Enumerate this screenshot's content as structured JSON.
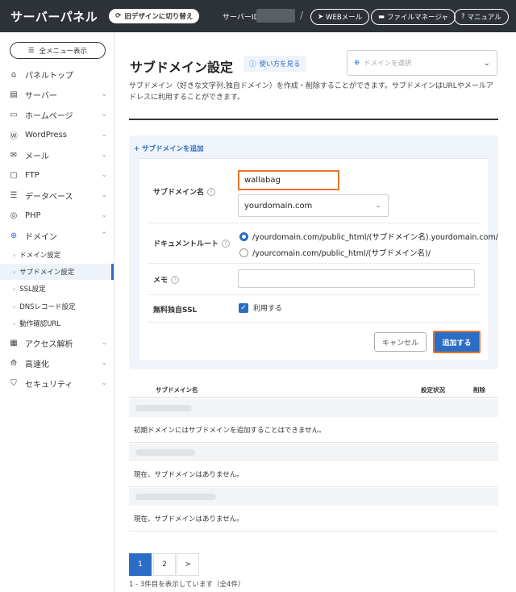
{
  "header": {
    "logo": "サーバーパネル",
    "old_design": "旧デザインに切り替え",
    "server_id_label": "サーバーID",
    "separator": "/",
    "webmail": "WEBメール",
    "file_manager": "ファイルマネージャ",
    "manual": "マニュアル"
  },
  "sidebar": {
    "all_menu": "全メニュー表示",
    "items": [
      {
        "label": "パネルトップ",
        "icon": "home-icon"
      },
      {
        "label": "サーバー",
        "icon": "server-icon"
      },
      {
        "label": "ホームページ",
        "icon": "window-icon"
      },
      {
        "label": "WordPress",
        "icon": "wordpress-icon"
      },
      {
        "label": "メール",
        "icon": "mail-icon"
      },
      {
        "label": "FTP",
        "icon": "monitor-icon"
      },
      {
        "label": "データベース",
        "icon": "database-icon"
      },
      {
        "label": "PHP",
        "icon": "php-icon"
      },
      {
        "label": "ドメイン",
        "icon": "globe-icon"
      }
    ],
    "domain_sub": [
      {
        "label": "ドメイン設定"
      },
      {
        "label": "サブドメイン設定"
      },
      {
        "label": "SSL設定"
      },
      {
        "label": "DNSレコード設定"
      },
      {
        "label": "動作確認URL"
      }
    ],
    "items_after": [
      {
        "label": "アクセス解析",
        "icon": "chart-icon"
      },
      {
        "label": "高速化",
        "icon": "speed-icon"
      },
      {
        "label": "セキュリティ",
        "icon": "shield-icon"
      }
    ]
  },
  "main": {
    "title": "サブドメイン設定",
    "help": "使い方を見る",
    "domain_select_placeholder": "ドメインを選択",
    "description": "サブドメイン（好きな文字列.独自ドメイン）を作成・削除することができます。サブドメインはURLやメールアドレスに利用することができます。",
    "add_link": "サブドメインを追加",
    "form": {
      "subdomain_label": "サブドメイン名",
      "subdomain_value": "wallabag",
      "domain_value": "yourdomain.com",
      "docroot_label": "ドキュメントルート",
      "docroot_option1": "/yourdomain.com/public_html/(サブドメイン名).yourdomain.com/",
      "docroot_option2": "/yourcomain.com/public_html/(サブドメイン名)/",
      "memo_label": "メモ",
      "ssl_label": "無料独自SSL",
      "ssl_option": "利用する",
      "cancel": "キャンセル",
      "submit": "追加する"
    },
    "table": {
      "col_name": "サブドメイン名",
      "col_status": "設定状況",
      "col_delete": "削除",
      "messages": [
        "初期ドメインにはサブドメインを追加することはできません。",
        "現在、サブドメインはありません。",
        "現在、サブドメインはありません。"
      ]
    },
    "pagination": {
      "p1": "1",
      "p2": "2",
      "next": ">"
    },
    "count_text": "1 - 3件目を表示しています（全4件）"
  },
  "colors": {
    "accent": "#2b6cc4",
    "highlight": "#e8762c",
    "header_bg": "#2d3238"
  }
}
